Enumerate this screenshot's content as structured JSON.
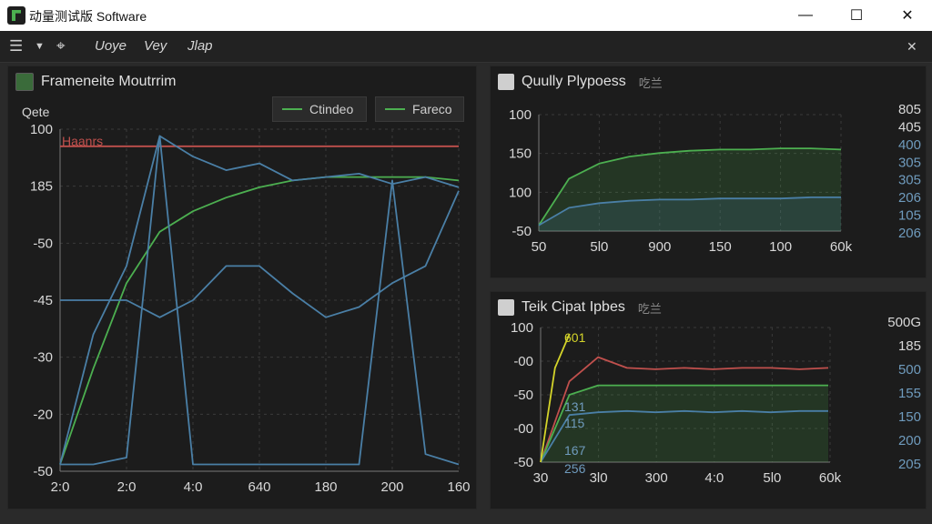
{
  "window": {
    "title": "动量测试版 Software",
    "minimize_glyph": "—",
    "maximize_glyph": "☐",
    "close_glyph": "✕"
  },
  "menubar": {
    "items": [
      "Uoye",
      "Vey",
      "Jlap"
    ],
    "close_glyph": "✕"
  },
  "icons": {
    "app": "app-logo-icon",
    "hamburger": "hamburger-icon",
    "dropdown": "chevron-down-icon",
    "tool": "tool-icon",
    "panel": "panel-icon"
  },
  "colors": {
    "green": "#4caf50",
    "red": "#c0504d",
    "blue": "#4a7fa6",
    "yellow": "#d4d42a",
    "panel_bg": "#1c1c1c"
  },
  "panel_left": {
    "title": "Frameneite Moutrrim",
    "legend": [
      {
        "label": "Ctindeo",
        "color": "#4caf50"
      },
      {
        "label": "Fareco",
        "color": "#4caf50"
      }
    ]
  },
  "panel_top_right": {
    "title": "Quully Plypoess",
    "subtitle": "吃兰"
  },
  "panel_bottom_right": {
    "title": "Teik Cipat Ipbes",
    "subtitle": "吃兰"
  },
  "chart_data": [
    {
      "type": "line",
      "title": "",
      "ylabel": "Qete",
      "y_ticks": [
        "100",
        "185",
        "-50",
        "-45",
        "-30",
        "-20",
        "-50"
      ],
      "x_ticks": [
        "2:0",
        "2:0",
        "4:0",
        "640",
        "180",
        "200",
        "160"
      ],
      "annotation": "Haanrs",
      "grid": true,
      "legend_position": "top-right",
      "series": [
        {
          "color": "#c0504d",
          "values": [
            0.95,
            0.95,
            0.95,
            0.95,
            0.95,
            0.95,
            0.95,
            0.95,
            0.95,
            0.95,
            0.95,
            0.95,
            0.95
          ]
        },
        {
          "color": "#4caf50",
          "values": [
            0.02,
            0.3,
            0.55,
            0.7,
            0.76,
            0.8,
            0.83,
            0.85,
            0.86,
            0.86,
            0.86,
            0.86,
            0.85
          ]
        },
        {
          "color": "#4a7fa6",
          "values": [
            0.02,
            0.4,
            0.6,
            0.98,
            0.92,
            0.88,
            0.9,
            0.85,
            0.86,
            0.87,
            0.84,
            0.86,
            0.83
          ]
        },
        {
          "color": "#4a7fa6",
          "values": [
            0.02,
            0.02,
            0.04,
            0.98,
            0.02,
            0.02,
            0.02,
            0.02,
            0.02,
            0.02,
            0.85,
            0.05,
            0.02
          ]
        },
        {
          "color": "#4a7fa6",
          "values": [
            0.5,
            0.5,
            0.5,
            0.45,
            0.5,
            0.6,
            0.6,
            0.52,
            0.45,
            0.48,
            0.55,
            0.6,
            0.82
          ]
        }
      ]
    },
    {
      "type": "area",
      "title": "",
      "y_ticks": [
        "100",
        "150",
        "100",
        "-50"
      ],
      "x_ticks": [
        "50",
        "5l0",
        "900",
        "150",
        "100",
        "60k"
      ],
      "right_ticks": [
        "805",
        "405",
        "400",
        "305",
        "305",
        "206",
        "105",
        "206"
      ],
      "grid": true,
      "series": [
        {
          "color": "#4caf50",
          "values": [
            0.05,
            0.45,
            0.58,
            0.64,
            0.67,
            0.69,
            0.7,
            0.7,
            0.71,
            0.71,
            0.7
          ]
        },
        {
          "color": "#4a7fa6",
          "values": [
            0.05,
            0.2,
            0.24,
            0.26,
            0.27,
            0.27,
            0.28,
            0.28,
            0.28,
            0.29,
            0.29
          ]
        }
      ]
    },
    {
      "type": "line",
      "title": "",
      "y_ticks": [
        "100",
        "-00",
        "-50",
        "-00",
        "-50"
      ],
      "x_ticks": [
        "30",
        "3l0",
        "300",
        "4:0",
        "5l0",
        "60k"
      ],
      "right_ticks": [
        "500G",
        "185",
        "500",
        "155",
        "150",
        "200",
        "205"
      ],
      "annotations": [
        "601",
        "131",
        "115",
        "167",
        "256"
      ],
      "grid": true,
      "series": [
        {
          "color": "#c0504d",
          "values": [
            0.0,
            0.6,
            0.78,
            0.7,
            0.69,
            0.7,
            0.69,
            0.7,
            0.7,
            0.69,
            0.7
          ]
        },
        {
          "color": "#4caf50",
          "values": [
            0.0,
            0.5,
            0.57,
            0.57,
            0.57,
            0.57,
            0.57,
            0.57,
            0.57,
            0.57,
            0.57
          ]
        },
        {
          "color": "#4a7fa6",
          "values": [
            0.0,
            0.35,
            0.37,
            0.38,
            0.37,
            0.38,
            0.37,
            0.38,
            0.37,
            0.38,
            0.38
          ]
        },
        {
          "color": "#d4d42a",
          "values": [
            0.0,
            0.7,
            0.95
          ]
        }
      ]
    }
  ]
}
